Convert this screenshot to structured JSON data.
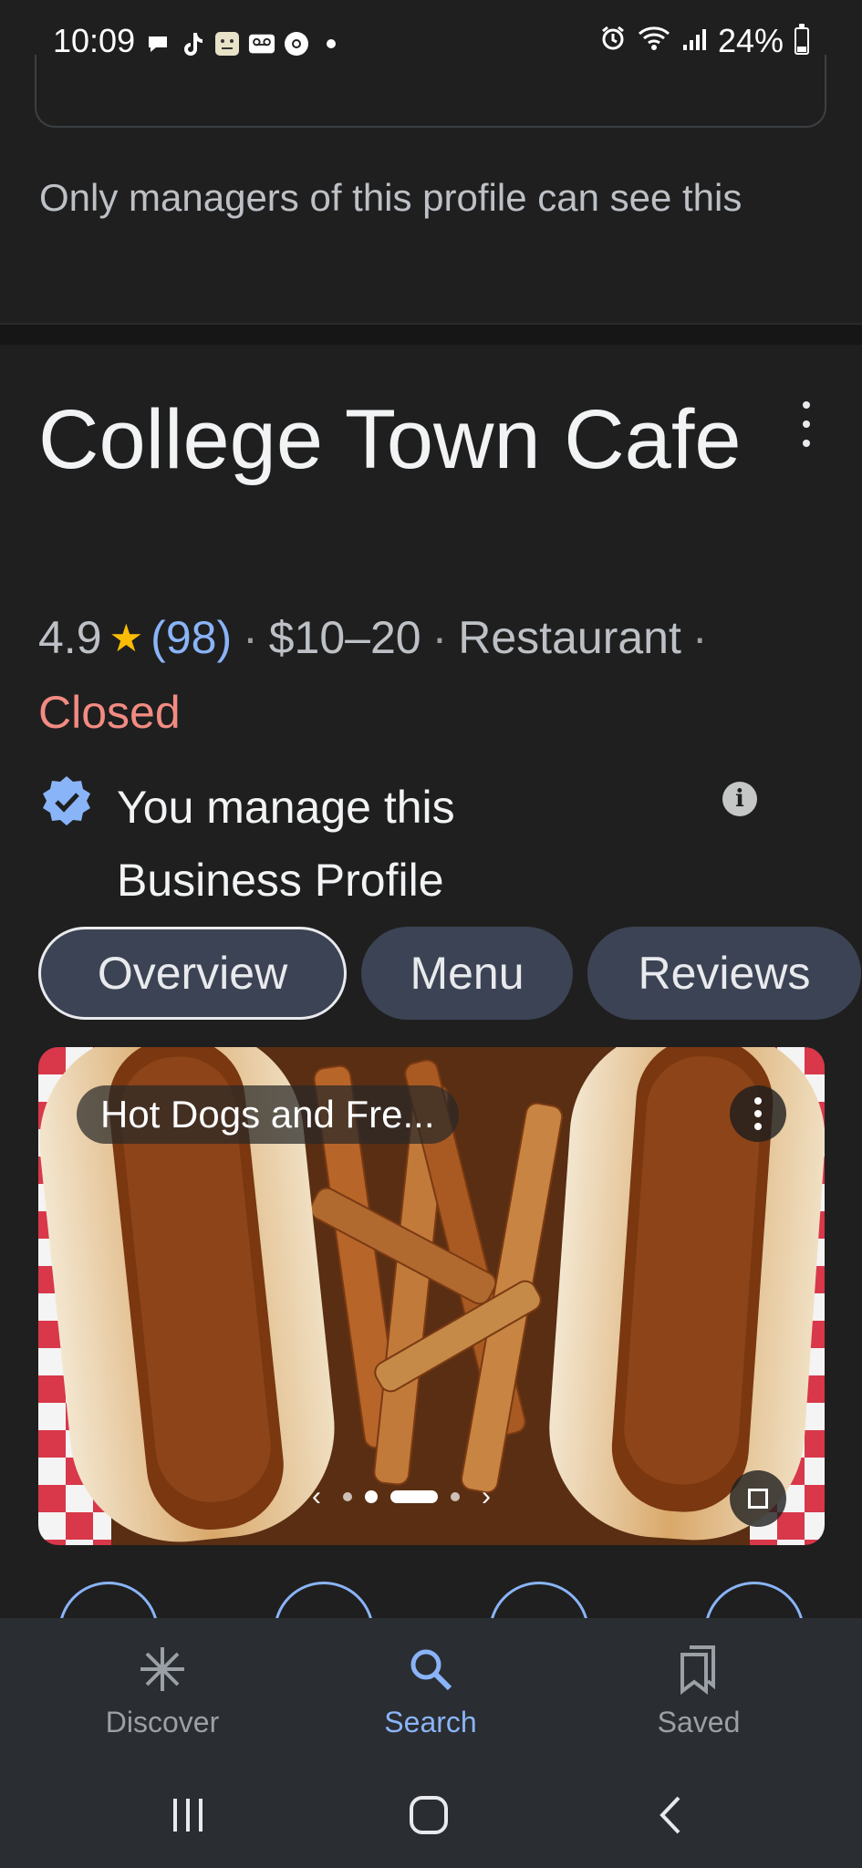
{
  "status_bar": {
    "time": "10:09",
    "battery": "24%",
    "battery_level": 0.24
  },
  "manager_note": "Only managers of this profile can see this",
  "place": {
    "title": "College Town Cafe",
    "rating": "4.9",
    "reviews": "(98)",
    "price": "$10–20",
    "category": "Restaurant",
    "trailing_sep": "·",
    "status": "Closed"
  },
  "verified": {
    "text": "You manage this Business Profile"
  },
  "tabs": [
    {
      "label": "Overview"
    },
    {
      "label": "Menu"
    },
    {
      "label": "Reviews"
    }
  ],
  "photo": {
    "caption": "Hot Dogs and Fre..."
  },
  "bottom_nav": [
    {
      "label": "Discover",
      "icon": "discover-icon"
    },
    {
      "label": "Search",
      "icon": "search-icon"
    },
    {
      "label": "Saved",
      "icon": "saved-icon"
    }
  ],
  "colors": {
    "accent": "#8ab4f8",
    "closed": "#f28b82",
    "star": "#fbbc04",
    "verified": "#8ab4f8"
  }
}
